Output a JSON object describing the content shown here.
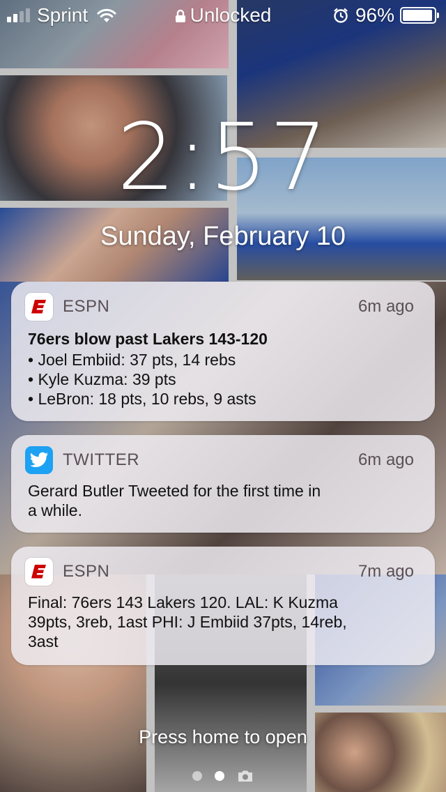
{
  "status_bar": {
    "carrier": "Sprint",
    "lock_status": "Unlocked",
    "battery_percent_label": "96%",
    "battery_level": 0.96,
    "signal_bars_filled": 2,
    "signal_bars_total": 4
  },
  "lock_screen": {
    "time": "2:57",
    "date": "Sunday, February 10",
    "press_home": "Press home to open"
  },
  "notifications": [
    {
      "app": "ESPN",
      "time": "6m ago",
      "title": "76ers blow past Lakers 143-120",
      "lines": [
        "• Joel Embiid: 37 pts, 14 rebs",
        "• Kyle Kuzma: 39 pts",
        "• LeBron: 18 pts, 10 rebs, 9 asts"
      ]
    },
    {
      "app": "TWITTER",
      "time": "6m ago",
      "lines": [
        "Gerard Butler Tweeted for the first time in",
        "a while."
      ]
    },
    {
      "app": "ESPN",
      "time": "7m ago",
      "lines": [
        "Final: 76ers 143 Lakers 120. LAL: K Kuzma",
        "39pts, 3reb, 1ast PHI: J Embiid 37pts, 14reb,",
        "3ast"
      ]
    }
  ],
  "colors": {
    "espn_red": "#cc0000",
    "twitter_blue": "#1da1f2"
  },
  "icons": {
    "wifi": "wifi-icon",
    "lock": "lock-icon",
    "alarm": "alarm-icon",
    "battery": "battery-icon",
    "camera": "camera-icon"
  }
}
